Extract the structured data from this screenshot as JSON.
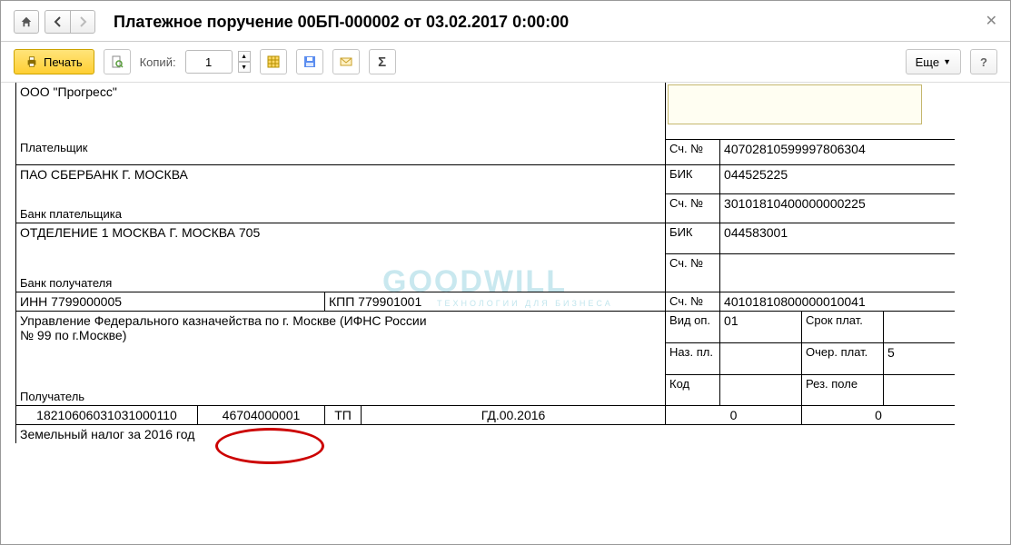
{
  "title": "Платежное поручение 00БП-000002 от 03.02.2017 0:00:00",
  "toolbar": {
    "print_label": "Печать",
    "copies_label": "Копий:",
    "copies_value": "1",
    "more_label": "Еще"
  },
  "doc": {
    "payer_name": "ООО \"Прогресс\"",
    "payer_label": "Плательщик",
    "payer_account_label": "Сч. №",
    "payer_account": "40702810599997806304",
    "payer_bank_name": "ПАО СБЕРБАНК Г. МОСКВА",
    "payer_bank_label": "Банк плательщика",
    "bik_label": "БИК",
    "payer_bik": "044525225",
    "payer_corr_label": "Сч. №",
    "payer_corr": "30101810400000000225",
    "recip_bank_name": "ОТДЕЛЕНИЕ 1 МОСКВА Г. МОСКВА 705",
    "recip_bank_label": "Банк получателя",
    "recip_bik": "044583001",
    "recip_corr_label": "Сч. №",
    "recip_inn": "ИНН 7799000005",
    "recip_kpp": "КПП 779901001",
    "recip_account_label": "Сч. №",
    "recip_account": "40101810800000010041",
    "recip_name": "Управление Федерального казначейства по г. Москве (ИФНС России № 99 по г.Москве)",
    "recip_label": "Получатель",
    "vid_op_label": "Вид оп.",
    "vid_op": "01",
    "srok_label": "Срок плат.",
    "naz_label": "Наз. пл.",
    "ocher_label": "Очер. плат.",
    "ocher": "5",
    "kod_label": "Код",
    "rez_label": "Рез. поле",
    "row_kbk": "18210606031031000110",
    "row_oktmo": "46704000001",
    "row_tp": "ТП",
    "row_period": "ГД.00.2016",
    "row_zero1": "0",
    "row_zero2": "0",
    "purpose": "Земельный налог за 2016 год"
  },
  "watermark": "GOODWILL",
  "watermark_sub": "ТЕХНОЛОГИИ ДЛЯ БИЗНЕСА"
}
